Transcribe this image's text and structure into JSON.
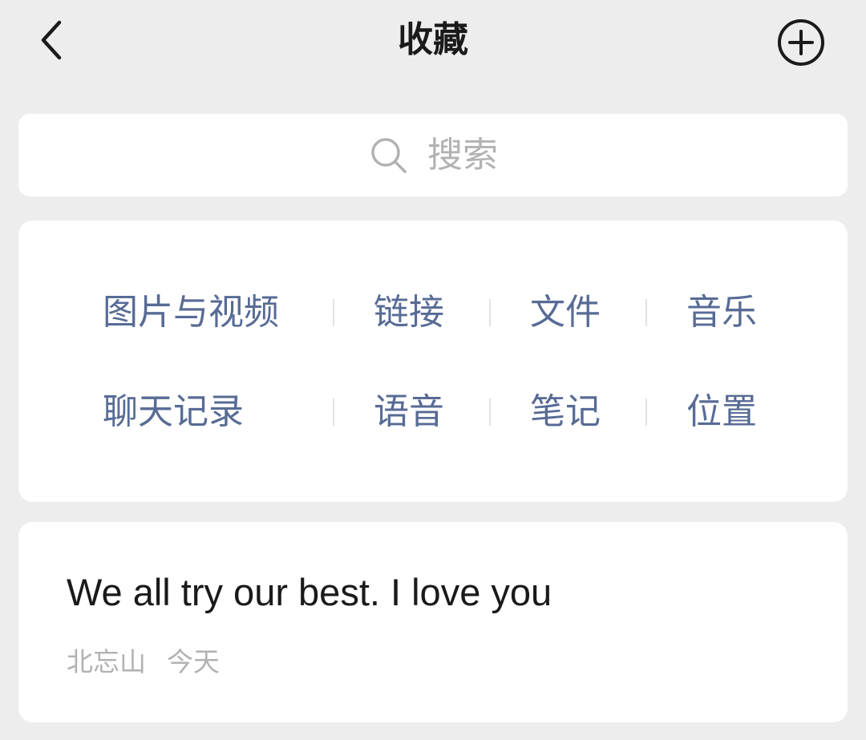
{
  "header": {
    "title": "收藏",
    "back_icon": "chevron-left-icon",
    "add_icon": "plus-circle-icon"
  },
  "search": {
    "placeholder": "搜索",
    "icon": "search-icon"
  },
  "categories": {
    "row1": [
      "图片与视频",
      "链接",
      "文件",
      "音乐"
    ],
    "row2": [
      "聊天记录",
      "语音",
      "笔记",
      "位置"
    ]
  },
  "favorites": [
    {
      "text": "We all try our best. I love you",
      "source": "北忘山",
      "date": "今天"
    }
  ],
  "colors": {
    "background": "#ededed",
    "card": "#ffffff",
    "link_blue": "#576b95",
    "placeholder_gray": "#b2b2b2",
    "text_dark": "#1a1a1a"
  }
}
